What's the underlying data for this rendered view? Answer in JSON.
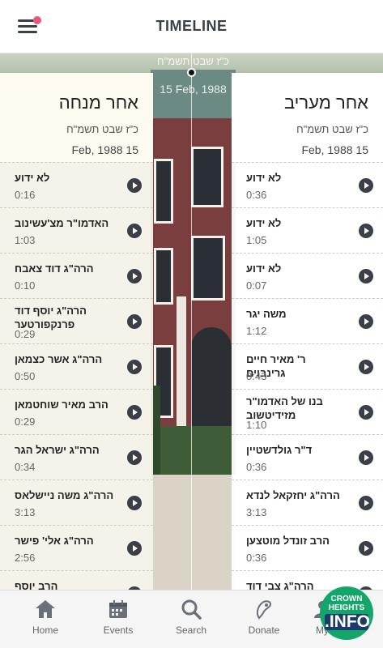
{
  "header": {
    "title": "TIMELINE"
  },
  "timeline": {
    "hebrew_date": "כ\"ז שבט תשמ\"ח",
    "date": "15 Feb, 1988"
  },
  "left": {
    "title": "אחר מנחה",
    "hebrew_date": "כ\"ז שבט תשמ\"ח",
    "date": "15 Feb, 1988",
    "items": [
      {
        "name": "לא ידוע",
        "duration": "0:16"
      },
      {
        "name": "האדמו\"ר מצ'עשינוב",
        "duration": "1:03"
      },
      {
        "name": "הרה\"ג דוד צאבח",
        "duration": "0:10"
      },
      {
        "name": "הרה\"ג יוסף דוד פרנקפורטער",
        "duration": "0:29"
      },
      {
        "name": "הרה\"ג אשר כצמאן",
        "duration": "0:50"
      },
      {
        "name": "הרב מאיר שוחטמאן",
        "duration": "0:29"
      },
      {
        "name": "הרה\"ג ישראל הגר",
        "duration": "0:34"
      },
      {
        "name": "הרה\"ג משה ניישלאס",
        "duration": "3:13"
      },
      {
        "name": "הרה\"ג אלי' פישר",
        "duration": "2:56"
      },
      {
        "name": "הרב יוסף גולדבערגער",
        "duration": ""
      }
    ]
  },
  "right": {
    "title": "אחר מעריב",
    "hebrew_date": "כ\"ז שבט תשמ\"ח",
    "date": "15 Feb, 1988",
    "items": [
      {
        "name": "לא ידוע",
        "duration": "0:36"
      },
      {
        "name": "לא ידוע",
        "duration": "1:05"
      },
      {
        "name": "לא ידוע",
        "duration": "0:07"
      },
      {
        "name": "משה יגר",
        "duration": "1:12"
      },
      {
        "name": "ר' מאיר חיים גרינבוים",
        "duration": "0:43"
      },
      {
        "name": "בנו של האדמו\"ר מזידיטשוב",
        "duration": "1:10"
      },
      {
        "name": "ד\"ר גולדשטיין",
        "duration": "0:36"
      },
      {
        "name": "הרה\"ג יחזקאל לנדא",
        "duration": "3:13"
      },
      {
        "name": "הרב זונדל מוטצען",
        "duration": "0:36"
      },
      {
        "name": "הרה\"ג צבי דוד",
        "duration": ""
      }
    ]
  },
  "tabs": [
    {
      "label": "Home",
      "icon": "home-icon"
    },
    {
      "label": "Events",
      "icon": "calendar-icon"
    },
    {
      "label": "Search",
      "icon": "search-icon"
    },
    {
      "label": "Donate",
      "icon": "donate-icon"
    },
    {
      "label": "My",
      "icon": "user-icon"
    }
  ],
  "watermark": {
    "line1": "CROWN",
    "line2": "HEIGHTS",
    "line3": ".INFO"
  },
  "colors": {
    "accent": "#3a3f4a",
    "notification": "#e8577a",
    "watermark_green": "#13a66b"
  }
}
